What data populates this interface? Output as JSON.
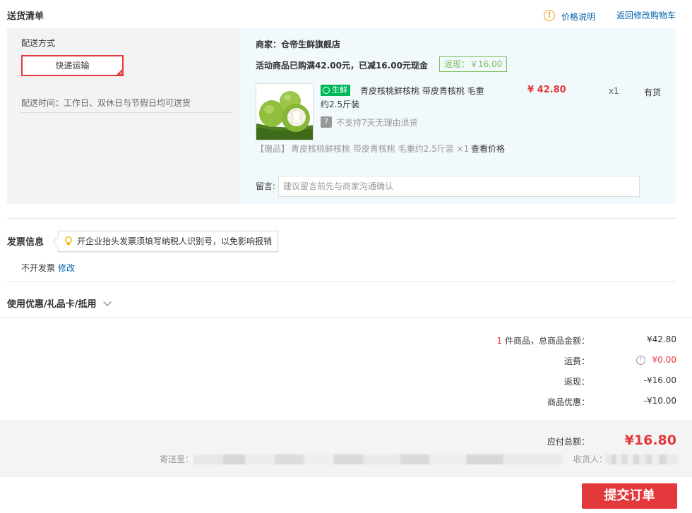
{
  "header": {
    "title": "送货清单",
    "price_note": "价格说明",
    "back_cart": "返回修改购物车"
  },
  "shipping": {
    "label": "配送方式",
    "method": "快递运输",
    "time": "配送时间：工作日、双休日与节假日均可送货"
  },
  "merchant": {
    "name": "商家：仓帝生鲜旗舰店",
    "promo": "活动商品已购满42.00元，已减16.00元现金",
    "fanxian": "返现：￥16.00"
  },
  "product": {
    "tag": "生鲜",
    "name_line1": "青皮核桃鲜核桃 带皮青核桃 毛重",
    "name_line2": "约2.5斤装",
    "price": "¥ 42.80",
    "qty": "x1",
    "stock": "有货",
    "return_icon": "7",
    "return_policy": "不支持7天无理由退货",
    "gift_prefix": "【赠品】",
    "gift_name": "青皮核桃鲜核桃 带皮青核桃 毛重约2.5斤装 ×1",
    "gift_link": "查看价格"
  },
  "remark": {
    "label": "留言:",
    "placeholder": "建议留言前先与商家沟通确认"
  },
  "invoice": {
    "title": "发票信息",
    "tip": "开企业抬头发票须填写纳税人识别号，以免影响报销",
    "status": "不开发票",
    "modify": "修改"
  },
  "coupon": {
    "title": "使用优惠/礼品卡/抵用"
  },
  "summary": {
    "count": "1",
    "count_suffix": "件商品，总商品金额：",
    "goods_amount": "¥42.80",
    "freight_label": "运费：",
    "freight": "¥0.00",
    "cashback_label": "返现：",
    "cashback": "-¥16.00",
    "discount_label": "商品优惠：",
    "discount": "-¥10.00"
  },
  "total": {
    "label": "应付总额：",
    "amount": "¥16.80",
    "ship_to": "寄送至：",
    "receiver": "收货人："
  },
  "submit": "提交订单",
  "colors": {
    "accent_red": "#e4393c",
    "link_blue": "#005ea7",
    "fresh_green": "#00b859",
    "fanxian_green": "#7abd54",
    "warn_orange": "#f29b13"
  }
}
